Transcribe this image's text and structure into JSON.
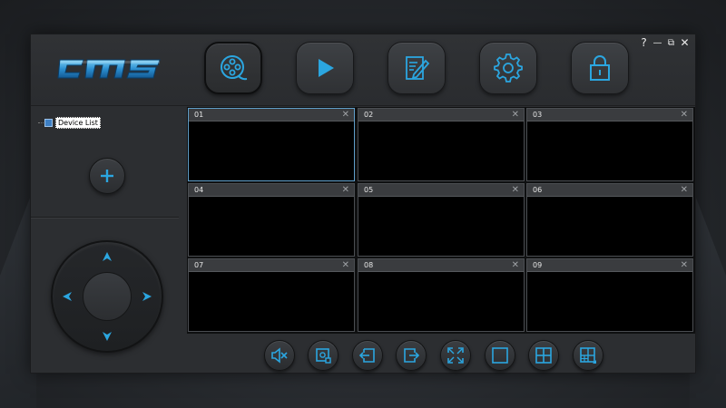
{
  "app": {
    "logo_text": "cms",
    "accent_color": "#2ba6e0"
  },
  "nav": [
    {
      "name": "live-view",
      "icon": "film-reel-icon",
      "active": true
    },
    {
      "name": "playback",
      "icon": "play-icon",
      "active": false
    },
    {
      "name": "log",
      "icon": "edit-document-icon",
      "active": false
    },
    {
      "name": "settings",
      "icon": "gear-icon",
      "active": false
    },
    {
      "name": "lock",
      "icon": "lock-icon",
      "active": false
    }
  ],
  "window_controls": {
    "help": "?",
    "minimize": "—",
    "restore": "⧉",
    "close": "✕"
  },
  "tree": {
    "root_label": "Device List"
  },
  "channels": [
    {
      "num": "01",
      "selected": true
    },
    {
      "num": "02",
      "selected": false
    },
    {
      "num": "03",
      "selected": false
    },
    {
      "num": "04",
      "selected": false
    },
    {
      "num": "05",
      "selected": false
    },
    {
      "num": "06",
      "selected": false
    },
    {
      "num": "07",
      "selected": false
    },
    {
      "num": "08",
      "selected": false
    },
    {
      "num": "09",
      "selected": false
    }
  ],
  "channel_close_glyph": "✕",
  "toolbar": [
    {
      "name": "mute",
      "icon": "mute-speaker-icon"
    },
    {
      "name": "snapshot",
      "icon": "capture-icon"
    },
    {
      "name": "previous-page",
      "icon": "page-back-icon"
    },
    {
      "name": "next-page",
      "icon": "page-forward-icon"
    },
    {
      "name": "fullscreen",
      "icon": "fullscreen-icon"
    },
    {
      "name": "layout-1",
      "icon": "single-view-icon"
    },
    {
      "name": "layout-4",
      "icon": "quad-view-icon"
    },
    {
      "name": "layout-custom",
      "icon": "multi-view-icon"
    }
  ]
}
